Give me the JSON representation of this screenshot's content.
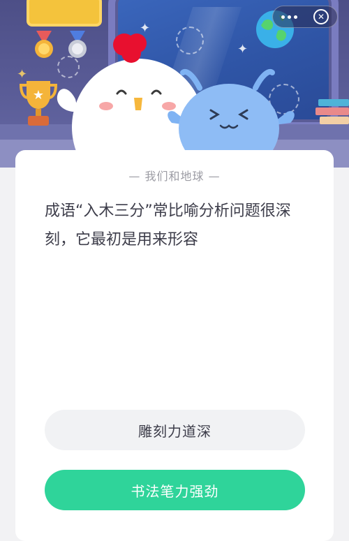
{
  "card": {
    "title": "— 我们和地球 —",
    "question": "成语“入木三分”常比喻分析问题很深刻，它最初是用来形容"
  },
  "options": [
    {
      "label": "雕刻力道深",
      "state": "default"
    },
    {
      "label": "书法笔力强劲",
      "state": "selected"
    }
  ],
  "colors": {
    "header_bg": "#4d4f87",
    "option_default_bg": "#f1f2f4",
    "option_selected_bg": "#2fd49a"
  },
  "icons": {
    "more": "more-dots-icon",
    "close": "close-icon"
  }
}
